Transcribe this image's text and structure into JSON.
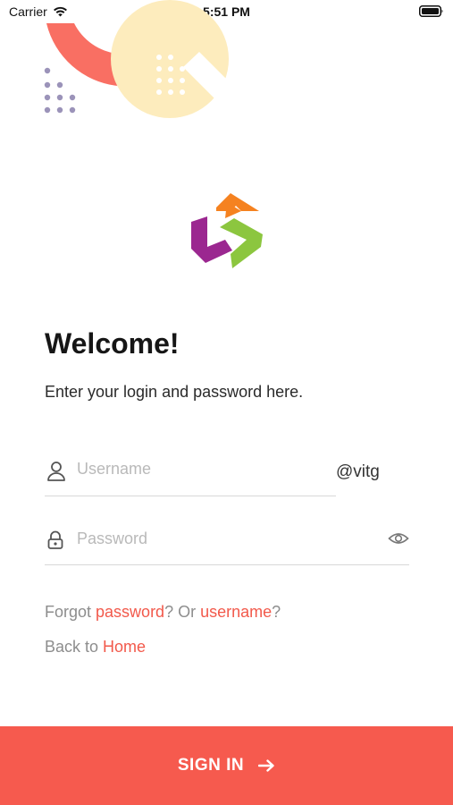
{
  "status_bar": {
    "carrier": "Carrier",
    "time": "5:51 PM",
    "icons": [
      "wifi-icon",
      "battery-icon"
    ]
  },
  "header": {
    "title": "Welcome!",
    "subtitle": "Enter your login and password here."
  },
  "form": {
    "username": {
      "placeholder": "Username",
      "value": "",
      "suffix": "@vitg",
      "icon": "user-icon"
    },
    "password": {
      "placeholder": "Password",
      "value": "",
      "icon": "lock-icon",
      "toggle_icon": "eye-icon"
    }
  },
  "links": {
    "forgot_prefix": "Forgot ",
    "password_link": "password",
    "or_text": "? Or ",
    "username_link": "username",
    "question": "?",
    "back_prefix": "Back to ",
    "home_link": "Home"
  },
  "sign_in": {
    "label": "SIGN IN",
    "icon": "arrow-right-icon"
  },
  "colors": {
    "accent": "#f65a4e",
    "link": "#f2594b",
    "decor_coral": "#f96f63",
    "decor_cream": "#fdecbd",
    "decor_dots": "#9b93b9",
    "logo_orange": "#f58220",
    "logo_purple": "#9b2790",
    "logo_green": "#8cc63f"
  }
}
